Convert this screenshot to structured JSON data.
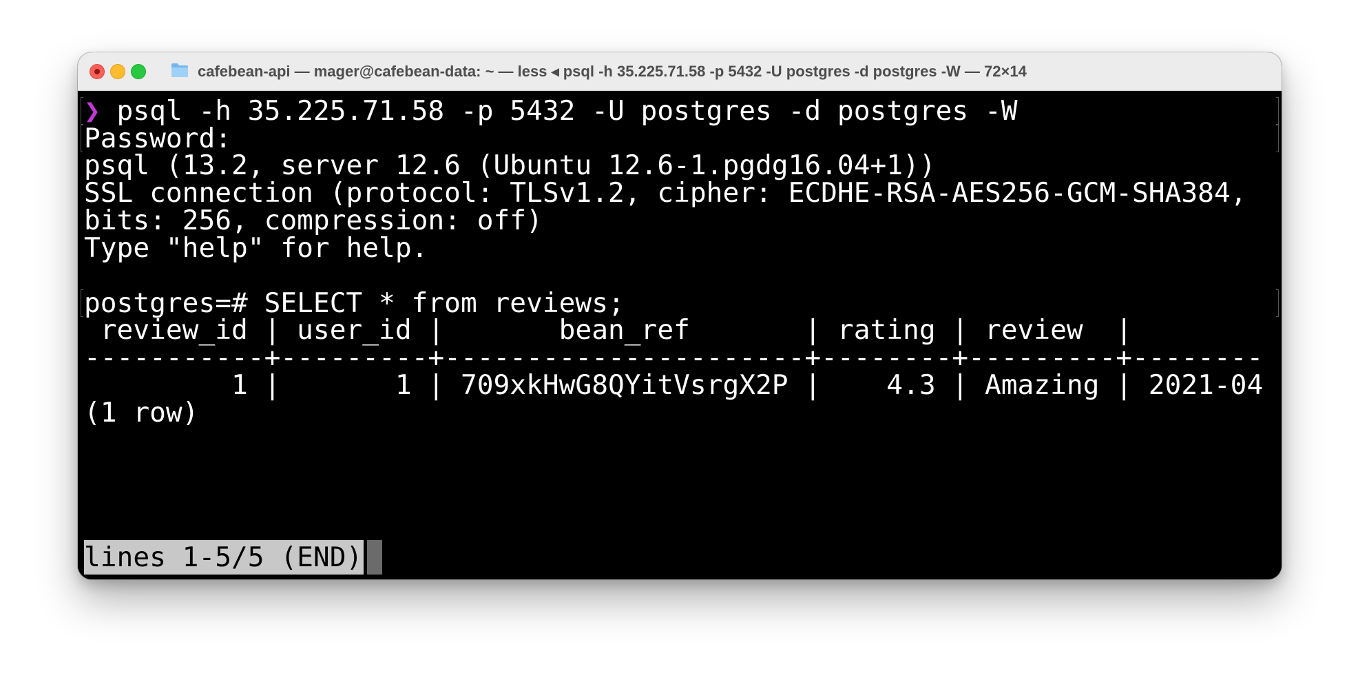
{
  "window": {
    "title": "cafebean-api — mager@cafebean-data: ~ — less ◂ psql -h 35.225.71.58 -p 5432 -U postgres -d postgres -W — 72×14"
  },
  "terminal": {
    "prompt_symbol": "❯",
    "command": " psql -h 35.225.71.58 -p 5432 -U postgres -d postgres -W",
    "lines": [
      "Password:",
      "psql (13.2, server 12.6 (Ubuntu 12.6-1.pgdg16.04+1))",
      "SSL connection (protocol: TLSv1.2, cipher: ECDHE-RSA-AES256-GCM-SHA384,",
      "bits: 256, compression: off)",
      "Type \"help\" for help.",
      "",
      "postgres=# SELECT * from reviews;",
      " review_id | user_id |       bean_ref       | rating | review  |",
      "-----------+---------+----------------------+--------+---------+--------",
      "         1 |       1 | 709xkHwG8QYitVsrgX2P |    4.3 | Amazing | 2021-04",
      "(1 row)"
    ],
    "status_line": "lines 1-5/5 (END)"
  },
  "colors": {
    "background": "#000000",
    "text": "#ffffff",
    "prompt": "#c239d6",
    "titlebar": "#ececec"
  },
  "icons": {
    "folder": "folder-icon",
    "close": "close-icon",
    "minimize": "minimize-icon",
    "zoom": "zoom-icon"
  }
}
